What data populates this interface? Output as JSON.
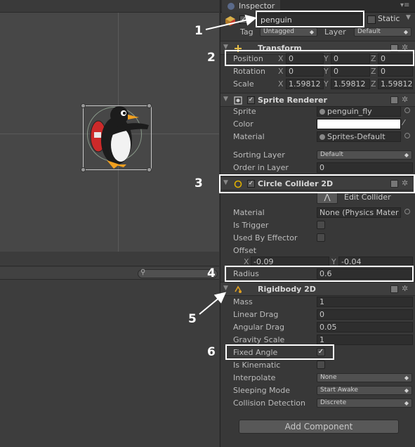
{
  "inspector": {
    "tab_label": "Inspector",
    "tab_menu": "▾≡",
    "object_name": "penguin",
    "static_label": "Static",
    "tag_label": "Tag",
    "tag_value": "Untagged",
    "layer_label": "Layer",
    "layer_value": "Default"
  },
  "transform": {
    "title": "Transform",
    "rows": [
      {
        "label": "Position",
        "x": "0",
        "y": "0",
        "z": "0"
      },
      {
        "label": "Rotation",
        "x": "0",
        "y": "0",
        "z": "0"
      },
      {
        "label": "Scale",
        "x": "1.59812",
        "y": "1.59812",
        "z": "1.59812"
      }
    ]
  },
  "axes": {
    "x": "X",
    "y": "Y",
    "z": "Z"
  },
  "sprite_renderer": {
    "title": "Sprite Renderer",
    "sprite_label": "Sprite",
    "sprite_value": "penguin_fly",
    "color_label": "Color",
    "material_label": "Material",
    "material_value": "Sprites-Default",
    "sorting_layer_label": "Sorting Layer",
    "sorting_layer_value": "Default",
    "order_label": "Order in Layer",
    "order_value": "0"
  },
  "circle_collider": {
    "title": "Circle Collider 2D",
    "edit_label": "Edit Collider",
    "material_label": "Material",
    "material_value": "None (Physics Mater",
    "trigger_label": "Is Trigger",
    "effector_label": "Used By Effector",
    "offset_label": "Offset",
    "offset_x": "-0.09",
    "offset_y": "-0.04",
    "radius_label": "Radius",
    "radius_value": "0.6"
  },
  "rigidbody": {
    "title": "Rigidbody 2D",
    "mass_label": "Mass",
    "mass_value": "1",
    "linear_drag_label": "Linear Drag",
    "linear_drag_value": "0",
    "angular_drag_label": "Angular Drag",
    "angular_drag_value": "0.05",
    "gravity_label": "Gravity Scale",
    "gravity_value": "1",
    "fixed_angle_label": "Fixed Angle",
    "kinematic_label": "Is Kinematic",
    "interpolate_label": "Interpolate",
    "interpolate_value": "None",
    "sleeping_label": "Sleeping Mode",
    "sleeping_value": "Start Awake",
    "collision_label": "Collision Detection",
    "collision_value": "Discrete"
  },
  "add_component": "Add Component",
  "annotations": [
    "1",
    "2",
    "3",
    "4",
    "5",
    "6"
  ],
  "colors": {
    "annotation": "#ffffff",
    "panel_bg": "#383838",
    "scene_bg": "#474747",
    "collider_icon": "#e0b000"
  }
}
